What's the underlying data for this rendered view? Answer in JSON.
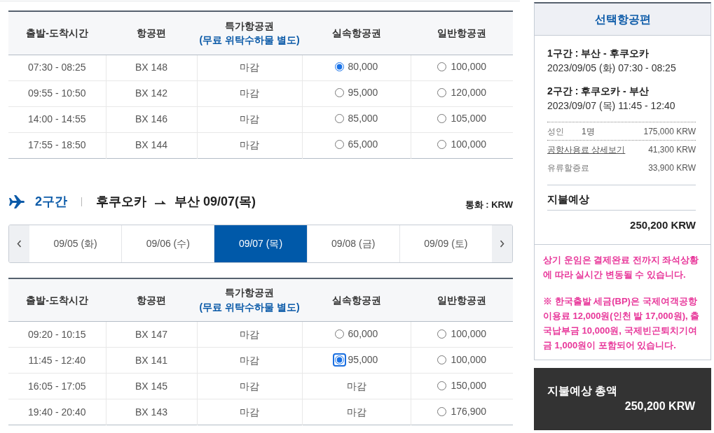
{
  "segment_1_table": {
    "columns": [
      {
        "label": "출발-도착시간"
      },
      {
        "label": "항공편"
      },
      {
        "label": "특가항공권",
        "note": "(무료 위탁수하물 별도)"
      },
      {
        "label": "실속항공권"
      },
      {
        "label": "일반항공권"
      }
    ],
    "rows": [
      {
        "time": "07:30 - 08:25",
        "flight": "BX 148",
        "fares": [
          {
            "kind": "closed",
            "text": "마감"
          },
          {
            "kind": "radio",
            "price": "80,000",
            "selected": true,
            "focused": false
          },
          {
            "kind": "radio",
            "price": "100,000",
            "selected": false,
            "focused": false
          }
        ]
      },
      {
        "time": "09:55 - 10:50",
        "flight": "BX 142",
        "fares": [
          {
            "kind": "closed",
            "text": "마감"
          },
          {
            "kind": "radio",
            "price": "95,000",
            "selected": false,
            "focused": false
          },
          {
            "kind": "radio",
            "price": "120,000",
            "selected": false,
            "focused": false
          }
        ]
      },
      {
        "time": "14:00 - 14:55",
        "flight": "BX 146",
        "fares": [
          {
            "kind": "closed",
            "text": "마감"
          },
          {
            "kind": "radio",
            "price": "85,000",
            "selected": false,
            "focused": false
          },
          {
            "kind": "radio",
            "price": "105,000",
            "selected": false,
            "focused": false
          }
        ]
      },
      {
        "time": "17:55 - 18:50",
        "flight": "BX 144",
        "fares": [
          {
            "kind": "closed",
            "text": "마감"
          },
          {
            "kind": "radio",
            "price": "65,000",
            "selected": false,
            "focused": false
          },
          {
            "kind": "radio",
            "price": "100,000",
            "selected": false,
            "focused": false
          }
        ]
      }
    ]
  },
  "segment_2": {
    "label": "2구간",
    "origin": "후쿠오카",
    "destination": "부산 09/07(목)",
    "currency": "통화 : KRW",
    "date_tabs": [
      {
        "label": "09/05 (화)",
        "selected": false
      },
      {
        "label": "09/06 (수)",
        "selected": false
      },
      {
        "label": "09/07 (목)",
        "selected": true
      },
      {
        "label": "09/08 (금)",
        "selected": false
      },
      {
        "label": "09/09 (토)",
        "selected": false
      }
    ],
    "table": {
      "columns": [
        {
          "label": "출발-도착시간"
        },
        {
          "label": "항공편"
        },
        {
          "label": "특가항공권",
          "note": "(무료 위탁수하물 별도)"
        },
        {
          "label": "실속항공권"
        },
        {
          "label": "일반항공권"
        }
      ],
      "rows": [
        {
          "time": "09:20 - 10:15",
          "flight": "BX 147",
          "fares": [
            {
              "kind": "closed",
              "text": "마감"
            },
            {
              "kind": "radio",
              "price": "60,000",
              "selected": false,
              "focused": false
            },
            {
              "kind": "radio",
              "price": "100,000",
              "selected": false,
              "focused": false
            }
          ]
        },
        {
          "time": "11:45 - 12:40",
          "flight": "BX 141",
          "fares": [
            {
              "kind": "closed",
              "text": "마감"
            },
            {
              "kind": "radio",
              "price": "95,000",
              "selected": true,
              "focused": true
            },
            {
              "kind": "radio",
              "price": "100,000",
              "selected": false,
              "focused": false
            }
          ]
        },
        {
          "time": "16:05 - 17:05",
          "flight": "BX 145",
          "fares": [
            {
              "kind": "closed",
              "text": "마감"
            },
            {
              "kind": "closed",
              "text": "마감"
            },
            {
              "kind": "radio",
              "price": "150,000",
              "selected": false,
              "focused": false
            }
          ]
        },
        {
          "time": "19:40 - 20:40",
          "flight": "BX 143",
          "fares": [
            {
              "kind": "closed",
              "text": "마감"
            },
            {
              "kind": "closed",
              "text": "마감"
            },
            {
              "kind": "radio",
              "price": "176,900",
              "selected": false,
              "focused": false
            }
          ]
        }
      ]
    }
  },
  "summary": {
    "title": "선택항공편",
    "segments": [
      {
        "title": "1구간 : 부산 - 후쿠오카",
        "schedule": "2023/09/05 (화) 07:30 - 08:25"
      },
      {
        "title": "2구간 : 후쿠오카 - 부산",
        "schedule": "2023/09/07 (목) 11:45 - 12:40"
      }
    ],
    "charges": [
      {
        "kind": "passenger",
        "label": "성인",
        "count": "1명",
        "amount": "175,000 KRW"
      },
      {
        "kind": "link",
        "label": "공항사용료 상세보기",
        "amount": "41,300 KRW"
      },
      {
        "kind": "plain",
        "label": "유류할증료",
        "amount": "33,900 KRW"
      }
    ],
    "estimate_label": "지불예상",
    "estimate_amount": "250,200 KRW"
  },
  "notice": {
    "paragraphs": [
      "상기 운임은 결제완료 전까지 좌석상황에 따라 실시간 변동될 수 있습니다.",
      "※ 한국출발 세금(BP)은 국제여객공항이용료 12,000원(인천 발 17,000원), 출국납부금 10,000원, 국제빈곤퇴치기여금 1,000원이 포함되어 있습니다."
    ]
  },
  "total": {
    "label": "지불예상 총액",
    "amount": "250,200 KRW"
  }
}
